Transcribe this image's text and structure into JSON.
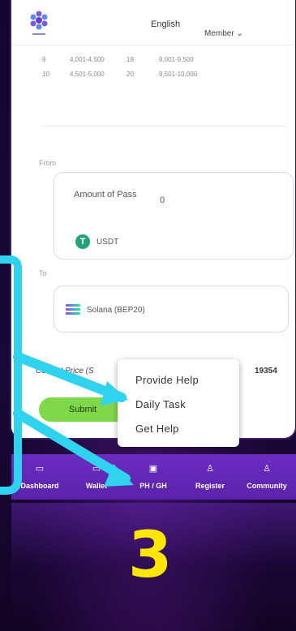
{
  "header": {
    "language": "English",
    "member": "Member ⌄"
  },
  "table_rows": [
    [
      "9",
      "4,001-4,500",
      "19",
      "9,001-9,500"
    ],
    [
      "10",
      "4,501-5,000",
      "20",
      "9,501-10,000"
    ]
  ],
  "form": {
    "from_label": "From",
    "amount_label": "Amount of Pass",
    "amount_value": "0",
    "from_token": "USDT",
    "to_label": "To",
    "to_chain": "Solana (BEP20)",
    "price_label": "Current Price (S",
    "price_value": "19354",
    "submit_label": "Submit"
  },
  "popup": {
    "items": [
      "Provide Help",
      "Daily Task",
      "Get Help"
    ]
  },
  "bottom_nav": {
    "items": [
      {
        "label": "Dashboard",
        "icon": "dashboard-icon"
      },
      {
        "label": "Wallet",
        "icon": "wallet-icon"
      },
      {
        "label": "PH / GH",
        "icon": "ph-gh-icon"
      },
      {
        "label": "Register",
        "icon": "register-icon"
      },
      {
        "label": "Community",
        "icon": "community-icon"
      }
    ]
  },
  "annotation": {
    "step_number": "3",
    "arrow_color": "#2fd3f0",
    "number_color": "#ffe600"
  },
  "colors": {
    "nav_bg": "#6c2cc4",
    "submit_bg": "#7fd84a",
    "usdt": "#26a17b"
  }
}
